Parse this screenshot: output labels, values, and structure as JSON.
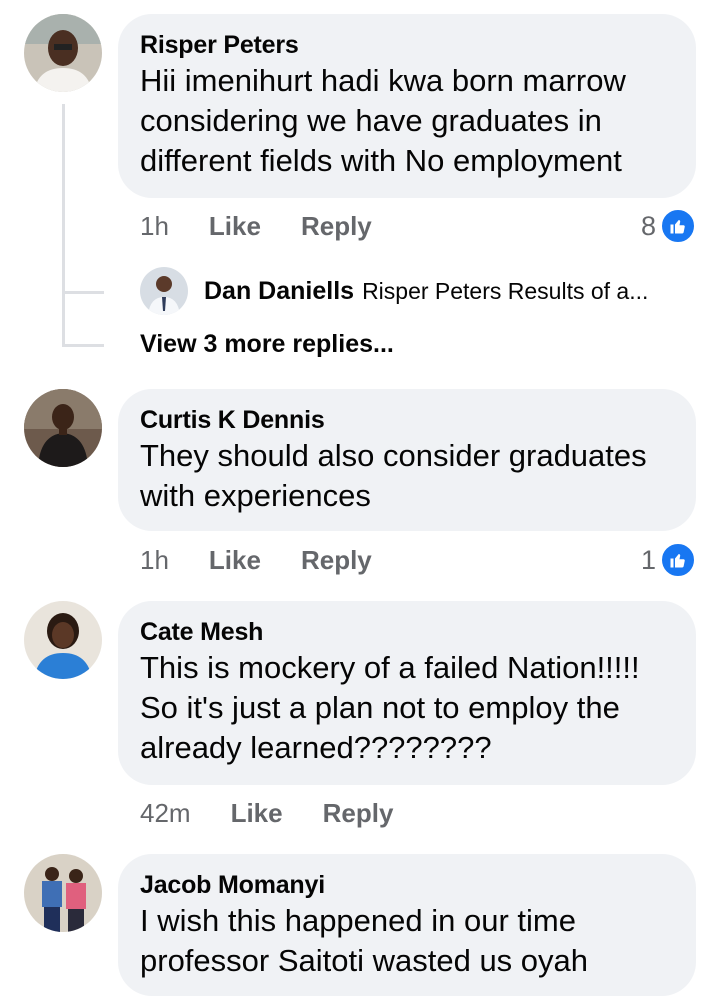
{
  "comments": [
    {
      "author": "Risper Peters",
      "lines": [
        "Hii imenihurt hadi kwa born marrow",
        "considering we have graduates in",
        "different fields with No employment"
      ],
      "time": "1h",
      "like": "Like",
      "reply": "Reply",
      "reactions": "8"
    },
    {
      "author": "Curtis K Dennis",
      "lines": [
        "They should also consider graduates",
        "with experiences"
      ],
      "time": "1h",
      "like": "Like",
      "reply": "Reply",
      "reactions": "1"
    },
    {
      "author": "Cate Mesh",
      "lines": [
        "This is mockery of a failed Nation!!!!!",
        "So it's just a plan not to employ the",
        "already learned????????"
      ],
      "time": "42m",
      "like": "Like",
      "reply": "Reply"
    },
    {
      "author": "Jacob Momanyi",
      "lines": [
        "I wish this happened in our time",
        "professor Saitoti wasted us oyah"
      ]
    }
  ],
  "reply_preview": {
    "author": "Dan Daniells",
    "text": "Risper Peters Results of a..."
  },
  "view_more": "View 3 more replies...",
  "colors": {
    "like_blue": "#1877f2",
    "bubble_bg": "#f0f2f5",
    "meta_gray": "#65676b"
  },
  "icons": {
    "reaction": "like-thumb-icon"
  }
}
